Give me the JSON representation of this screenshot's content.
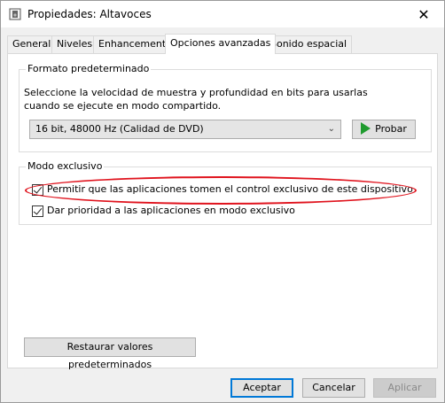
{
  "window": {
    "title": "Propiedades: Altavoces",
    "close_glyph": "✕"
  },
  "tabs": [
    {
      "label": "General"
    },
    {
      "label": "Niveles"
    },
    {
      "label": "Enhancements"
    },
    {
      "label": "Opciones avanzadas"
    },
    {
      "label": "Sonido espacial"
    }
  ],
  "default_format": {
    "group_label": "Formato predeterminado",
    "description": "Seleccione la velocidad de muestra y profundidad en bits para usarlas cuando se ejecute en modo compartido.",
    "selected_format": "16 bit, 48000 Hz (Calidad de DVD)",
    "test_button": "Probar"
  },
  "exclusive_mode": {
    "group_label": "Modo exclusivo",
    "options": [
      {
        "label": "Permitir que las aplicaciones tomen el control exclusivo de este dispositivo",
        "checked": true
      },
      {
        "label": "Dar prioridad a las aplicaciones en modo exclusivo",
        "checked": true
      }
    ]
  },
  "buttons": {
    "restore": "Restaurar valores predeterminados",
    "accept": "Aceptar",
    "cancel": "Cancelar",
    "apply": "Aplicar"
  },
  "colors": {
    "annotation": "#e0141e",
    "play": "#1f9b2e",
    "default_button_border": "#0078d7"
  }
}
